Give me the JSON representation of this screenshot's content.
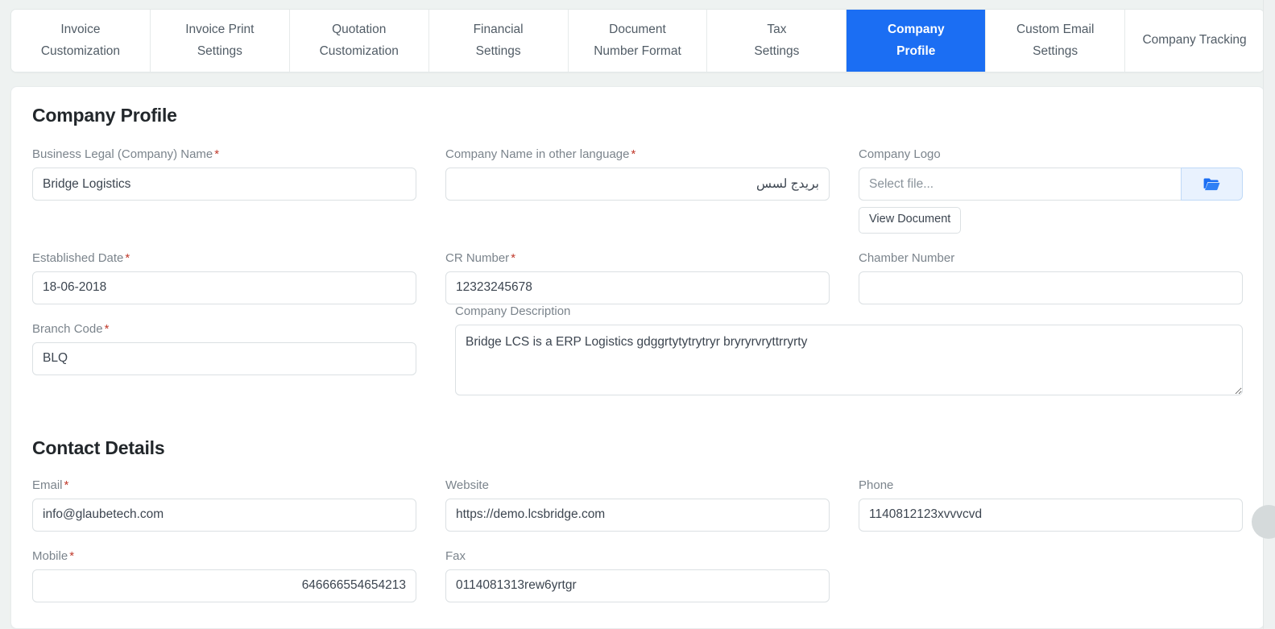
{
  "tabs": [
    {
      "line1": "Invoice",
      "line2": "Customization",
      "active": false
    },
    {
      "line1": "Invoice Print",
      "line2": "Settings",
      "active": false
    },
    {
      "line1": "Quotation",
      "line2": "Customization",
      "active": false
    },
    {
      "line1": "Financial",
      "line2": "Settings",
      "active": false
    },
    {
      "line1": "Document",
      "line2": "Number Format",
      "active": false
    },
    {
      "line1": "Tax",
      "line2": "Settings",
      "active": false
    },
    {
      "line1": "Company",
      "line2": "Profile",
      "active": true
    },
    {
      "line1": "Custom Email",
      "line2": "Settings",
      "active": false
    },
    {
      "line1": "Company Tracking",
      "line2": "",
      "active": false
    }
  ],
  "sections": {
    "company_profile_title": "Company Profile",
    "contact_details_title": "Contact Details"
  },
  "fields": {
    "business_legal_name": {
      "label": "Business Legal (Company) Name",
      "required": "*",
      "value": "Bridge Logistics"
    },
    "company_name_other_language": {
      "label": "Company Name in other language",
      "required": "*",
      "value": "بريدج لسس"
    },
    "company_logo": {
      "label": "Company Logo",
      "placeholder": "Select file...",
      "value": "",
      "browse_icon": "folder-open-icon",
      "view_document_label": "View Document"
    },
    "established_date": {
      "label": "Established Date",
      "required": "*",
      "value": "18-06-2018"
    },
    "cr_number": {
      "label": "CR Number",
      "required": "*",
      "value": "12323245678"
    },
    "chamber_number": {
      "label": "Chamber Number",
      "required": "",
      "value": ""
    },
    "branch_code": {
      "label": "Branch Code",
      "required": "*",
      "value": "BLQ"
    },
    "company_description": {
      "label": "Company Description",
      "required": "",
      "value": "Bridge LCS is a ERP Logistics gdggrtytytrytryr bryryrvryttrryrty"
    },
    "email": {
      "label": "Email",
      "required": "*",
      "value": "info@glaubetech.com"
    },
    "website": {
      "label": "Website",
      "required": "",
      "value": "https://demo.lcsbridge.com"
    },
    "phone": {
      "label": "Phone",
      "required": "",
      "value": "1140812123xvvvcvd"
    },
    "mobile": {
      "label": "Mobile",
      "required": "*",
      "value": "646666554654213"
    },
    "fax": {
      "label": "Fax",
      "required": "",
      "value": "0114081313rew6yrtgr"
    }
  },
  "colors": {
    "accent": "#1b6ef3",
    "page_background": "#eef2f1",
    "required_marker": "#c0392b",
    "browse_button_background": "#e9f2fe"
  }
}
